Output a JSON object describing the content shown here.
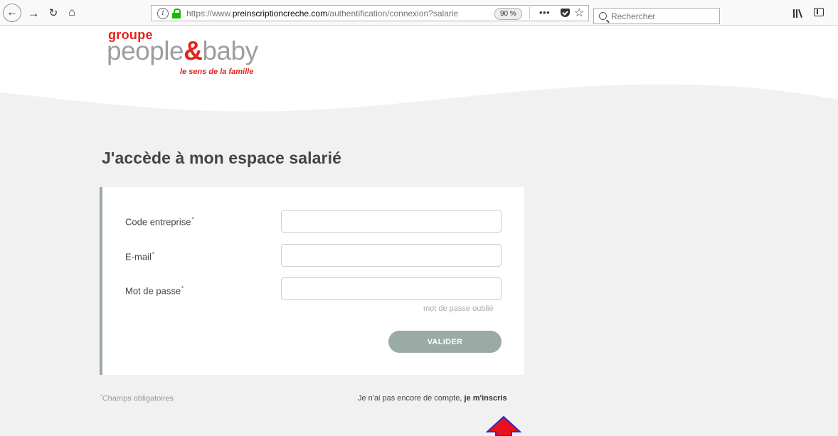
{
  "browser": {
    "url_prefix": "https://www.",
    "url_domain": "preinscriptioncreche.com",
    "url_path": "/authentification/connexion?salarie",
    "zoom": "90 %",
    "more_actions": "•••",
    "search_placeholder": "Rechercher",
    "icons": [
      "back-arrow-icon",
      "forward-arrow-icon",
      "reload-icon",
      "home-icon",
      "info-icon",
      "lock-icon",
      "pocket-icon",
      "bookmark-star-icon",
      "search-icon",
      "library-icon",
      "sidebar-icon"
    ]
  },
  "brand": {
    "groupe": "groupe",
    "name_part1": "people",
    "ampersand": "&",
    "name_part2": "baby",
    "tagline": "le sens de la famille"
  },
  "page": {
    "title": "J'accède à mon espace salarié"
  },
  "form": {
    "fields": [
      {
        "label": "Code entreprise",
        "required_mark": "*",
        "value": ""
      },
      {
        "label": "E-mail",
        "required_mark": "*",
        "value": ""
      },
      {
        "label": "Mot de passe",
        "required_mark": "*",
        "value": ""
      }
    ],
    "forgot_password": "mot de passe oublié",
    "submit": "VALIDER"
  },
  "footer": {
    "required_mark": "*",
    "required_note": "Champs obligatoires",
    "no_account_text": "Je n'ai pas encore de compte, ",
    "signup_link": "je m'inscris"
  },
  "colors": {
    "brand_red": "#e2231a",
    "brand_gray": "#9e9e9e",
    "accent_teal_gray": "#9aa9a4",
    "annotation_arrow_fill": "#e8101a",
    "annotation_arrow_stroke": "#2d2ad0"
  }
}
